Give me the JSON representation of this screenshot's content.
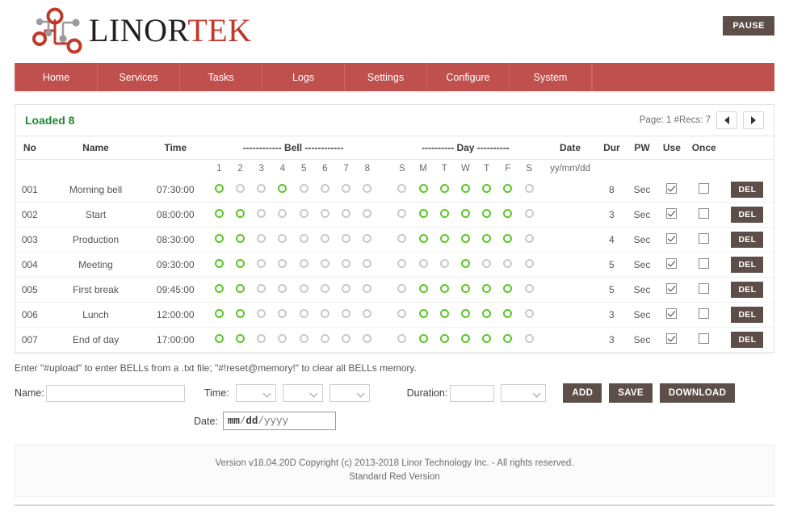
{
  "header": {
    "logo_dark": "LINOR",
    "logo_red": "TEK",
    "logo_icon": "circuit-nodes-logo",
    "pause_label": "PAUSE"
  },
  "nav": {
    "items": [
      {
        "label": "Home"
      },
      {
        "label": "Services"
      },
      {
        "label": "Tasks"
      },
      {
        "label": "Logs"
      },
      {
        "label": "Settings"
      },
      {
        "label": "Configure"
      },
      {
        "label": "System"
      }
    ]
  },
  "panel": {
    "loaded_label": "Loaded 8",
    "page_info": "Page: 1 #Recs: 7",
    "prev_icon": "triangle-left-icon",
    "next_icon": "triangle-right-icon"
  },
  "table": {
    "headers": {
      "no": "No",
      "name": "Name",
      "time": "Time",
      "bell": "------------ Bell ------------",
      "day": "---------- Day ----------",
      "date": "Date",
      "dur": "Dur",
      "pw": "PW",
      "use": "Use",
      "once": "Once"
    },
    "bell_numbers": [
      "1",
      "2",
      "3",
      "4",
      "5",
      "6",
      "7",
      "8"
    ],
    "day_letters": [
      "S",
      "M",
      "T",
      "W",
      "T",
      "F",
      "S"
    ],
    "date_format": "yy/mm/dd",
    "del_label": "DEL",
    "rows": [
      {
        "no": "001",
        "name": "Morning bell",
        "time": "07:30:00",
        "bells": [
          true,
          false,
          false,
          true,
          false,
          false,
          false,
          false
        ],
        "days": [
          false,
          true,
          true,
          true,
          true,
          true,
          false
        ],
        "date": "",
        "dur": "8",
        "pw": "Sec",
        "use": true,
        "once": false
      },
      {
        "no": "002",
        "name": "Start",
        "time": "08:00:00",
        "bells": [
          true,
          true,
          false,
          false,
          false,
          false,
          false,
          false
        ],
        "days": [
          false,
          true,
          true,
          true,
          true,
          true,
          false
        ],
        "date": "",
        "dur": "3",
        "pw": "Sec",
        "use": true,
        "once": false
      },
      {
        "no": "003",
        "name": "Production",
        "time": "08:30:00",
        "bells": [
          true,
          true,
          false,
          false,
          false,
          false,
          false,
          false
        ],
        "days": [
          false,
          true,
          true,
          true,
          true,
          true,
          false
        ],
        "date": "",
        "dur": "4",
        "pw": "Sec",
        "use": true,
        "once": false
      },
      {
        "no": "004",
        "name": "Meeting",
        "time": "09:30:00",
        "bells": [
          true,
          true,
          false,
          false,
          false,
          false,
          false,
          false
        ],
        "days": [
          false,
          false,
          false,
          true,
          false,
          false,
          false
        ],
        "date": "",
        "dur": "5",
        "pw": "Sec",
        "use": true,
        "once": false
      },
      {
        "no": "005",
        "name": "First break",
        "time": "09:45:00",
        "bells": [
          true,
          true,
          false,
          false,
          false,
          false,
          false,
          false
        ],
        "days": [
          false,
          true,
          true,
          true,
          true,
          true,
          false
        ],
        "date": "",
        "dur": "5",
        "pw": "Sec",
        "use": true,
        "once": false
      },
      {
        "no": "006",
        "name": "Lunch",
        "time": "12:00:00",
        "bells": [
          true,
          true,
          false,
          false,
          false,
          false,
          false,
          false
        ],
        "days": [
          false,
          true,
          true,
          true,
          true,
          true,
          false
        ],
        "date": "",
        "dur": "3",
        "pw": "Sec",
        "use": true,
        "once": false
      },
      {
        "no": "007",
        "name": "End of day",
        "time": "17:00:00",
        "bells": [
          true,
          true,
          false,
          false,
          false,
          false,
          false,
          false
        ],
        "days": [
          false,
          true,
          true,
          true,
          true,
          true,
          false
        ],
        "date": "",
        "dur": "3",
        "pw": "Sec",
        "use": true,
        "once": false
      }
    ]
  },
  "form": {
    "hint": "Enter \"#upload\" to enter BELLs from a .txt file; \"#!reset@memory!\" to clear all BELLs memory.",
    "name_label": "Name:",
    "name_value": "",
    "time_label": "Time:",
    "time_hour": "",
    "time_minute": "",
    "time_second": "",
    "duration_label": "Duration:",
    "duration_value": "",
    "duration_unit": "",
    "date_label": "Date:",
    "date_placeholder_mm": "mm",
    "date_placeholder_dd": "dd",
    "date_placeholder_yyyy": "yyyy",
    "add_label": "ADD",
    "save_label": "SAVE",
    "download_label": "DOWNLOAD"
  },
  "footer": {
    "line1": "Version v18.04.20D Copyright (c) 2013-2018 Linor Technology Inc. - All rights reserved.",
    "line2": "Standard Red Version"
  },
  "colors": {
    "nav_red": "#c0504d",
    "brand_red": "#c0392b",
    "button_brown": "#5d4e4a",
    "active_green": "#5bc628",
    "loaded_green": "#1e8a33",
    "inactive_gray": "#c9c9c9"
  }
}
